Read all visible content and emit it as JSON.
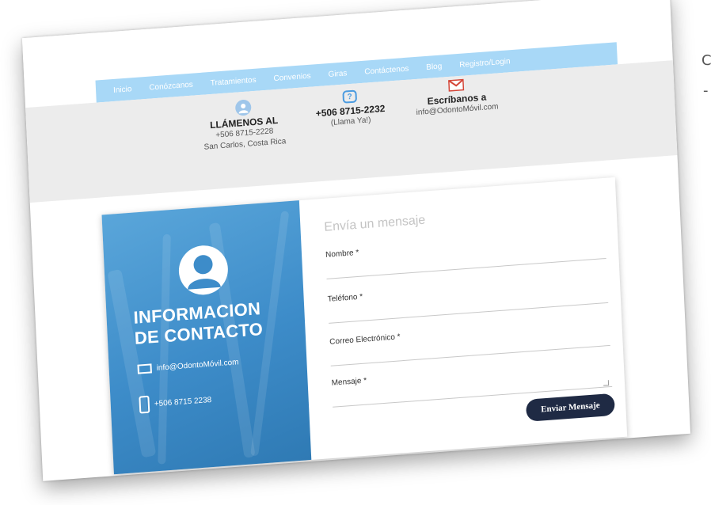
{
  "nav": {
    "items": [
      "Inicio",
      "Conózcanos",
      "Tratamientos",
      "Convenios",
      "Giras",
      "Contáctenos",
      "Blog",
      "Registro/Login"
    ]
  },
  "info": {
    "call": {
      "title": "LLÁMENOS AL",
      "phone": "+506 8715-2228",
      "location": "San Carlos, Costa Rica"
    },
    "whatsapp": {
      "phone": "+506 8715-2232",
      "note": "(Llama Ya!)"
    },
    "email": {
      "title": "Escríbanos a",
      "address": "info@OdontoMóvil.com"
    }
  },
  "panel": {
    "title_line1": "INFORMACION",
    "title_line2": "DE CONTACTO",
    "email": "info@OdontoMóvil.com",
    "phone": "+506 8715 2238"
  },
  "form": {
    "heading": "Envía un mensaje",
    "fields": {
      "name": "Nombre *",
      "phone": "Teléfono *",
      "email": "Correo Electrónico *",
      "message": "Mensaje *"
    },
    "submit": "Enviar Mensaje"
  },
  "edge": {
    "char1": "C",
    "char2": "-"
  },
  "colors": {
    "nav_bg": "#a8d8f7",
    "panel_bg": "#3d8cc9",
    "button_bg": "#1f2a44"
  }
}
